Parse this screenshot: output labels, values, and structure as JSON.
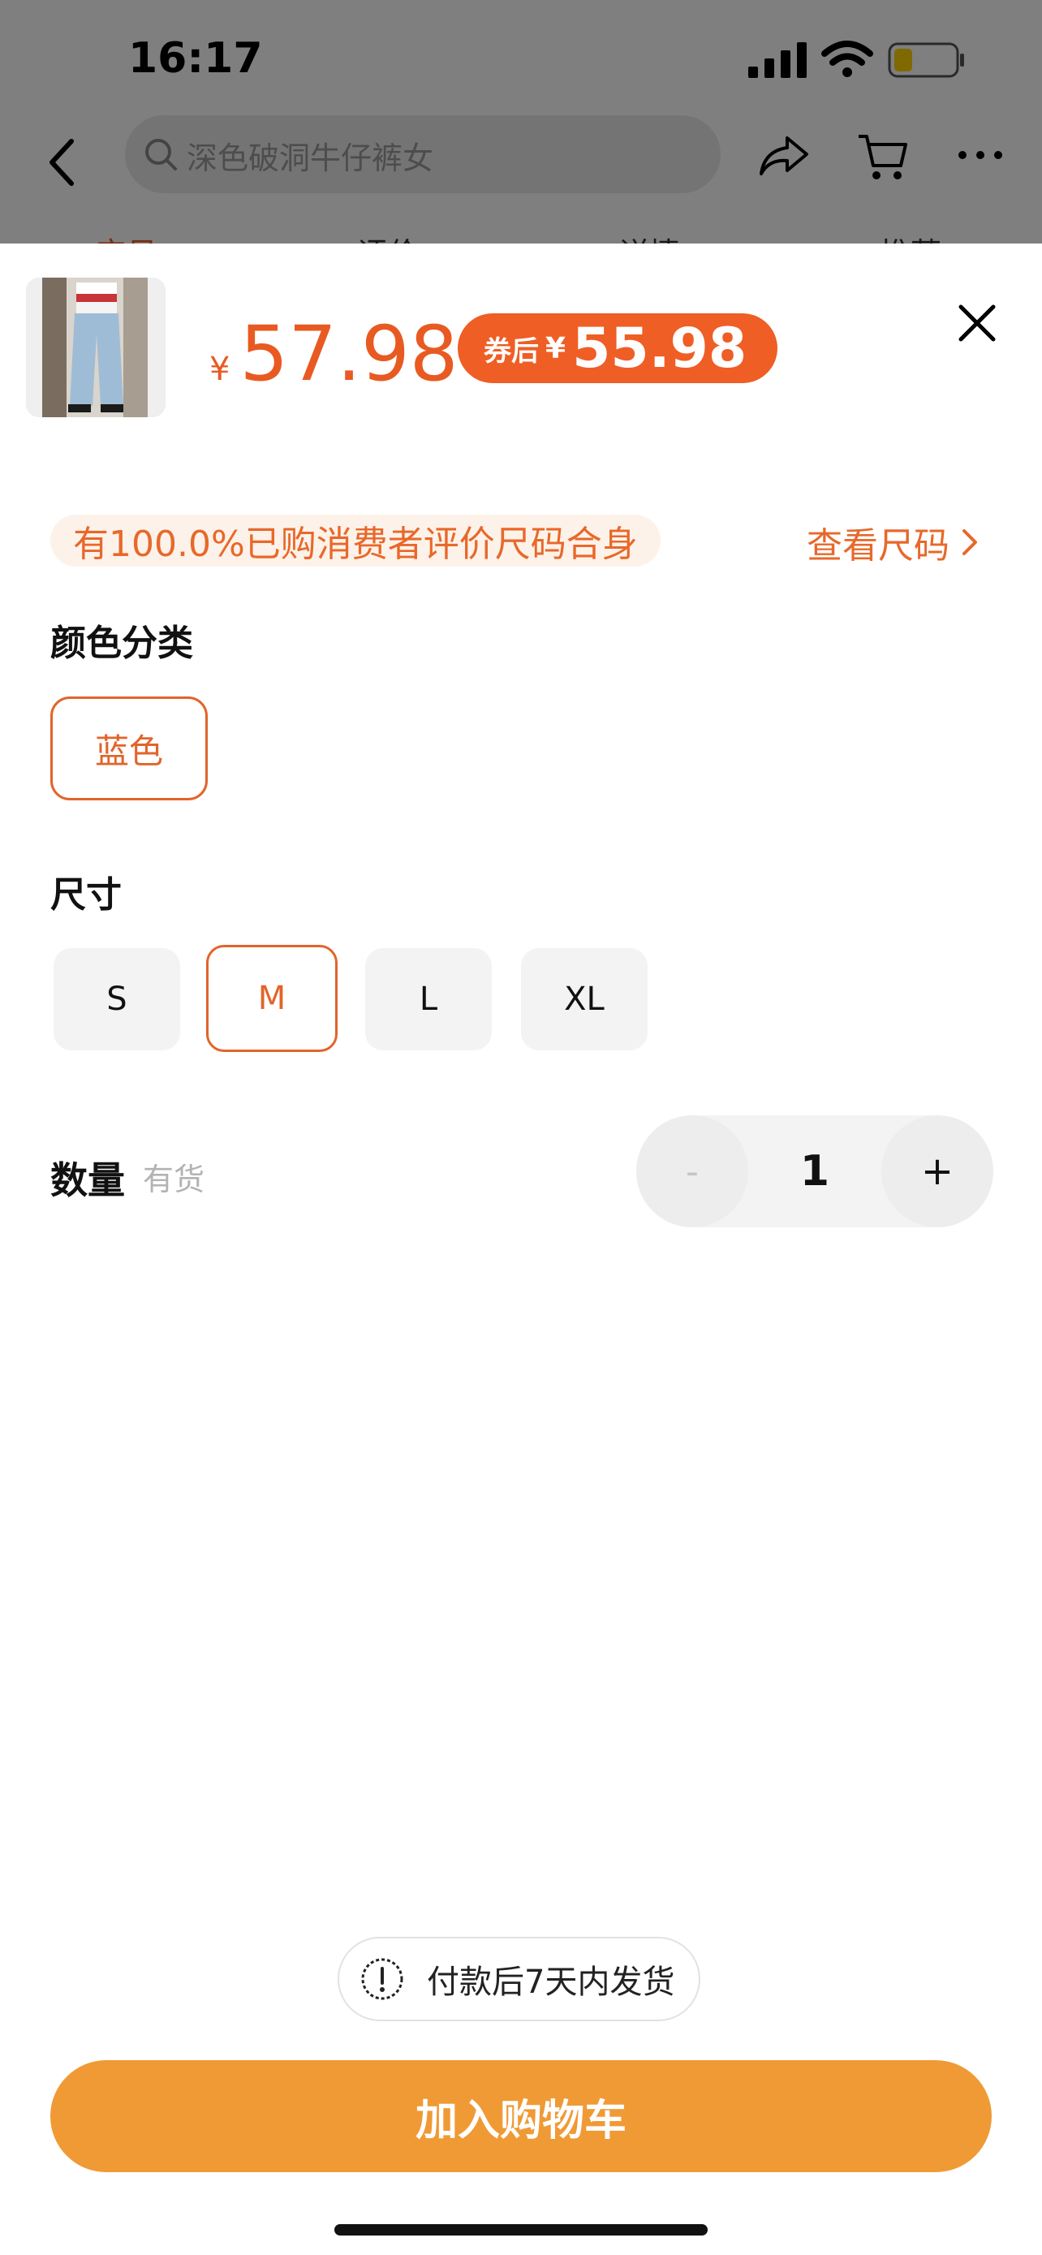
{
  "status_bar": {
    "time": "16:17"
  },
  "header": {
    "search_text": "深色破洞牛仔裤女",
    "tabs": [
      "宝贝",
      "评价",
      "详情",
      "推荐"
    ]
  },
  "sheet": {
    "price_symbol": "¥",
    "price": "57.98",
    "coupon_label": "券后",
    "coupon_symbol": "¥",
    "coupon_price": "55.98",
    "fit_text": "有100.0%已购消费者评价尺码合身",
    "view_size_label": "查看尺码",
    "color_section_title": "颜色分类",
    "colors": [
      {
        "label": "蓝色",
        "selected": true
      }
    ],
    "size_section_title": "尺寸",
    "sizes": [
      {
        "label": "S",
        "selected": false
      },
      {
        "label": "M",
        "selected": true
      },
      {
        "label": "L",
        "selected": false
      },
      {
        "label": "XL",
        "selected": false
      }
    ],
    "quantity_label": "数量",
    "stock_status": "有货",
    "quantity": "1",
    "minus_label": "-",
    "plus_label": "+",
    "shipping_note": "付款后7天内发货",
    "add_to_cart_label": "加入购物车"
  },
  "colors": {
    "accent": "#E85A22",
    "coupon_bg": "#EF5E25",
    "cart_button": "#F09A35"
  }
}
